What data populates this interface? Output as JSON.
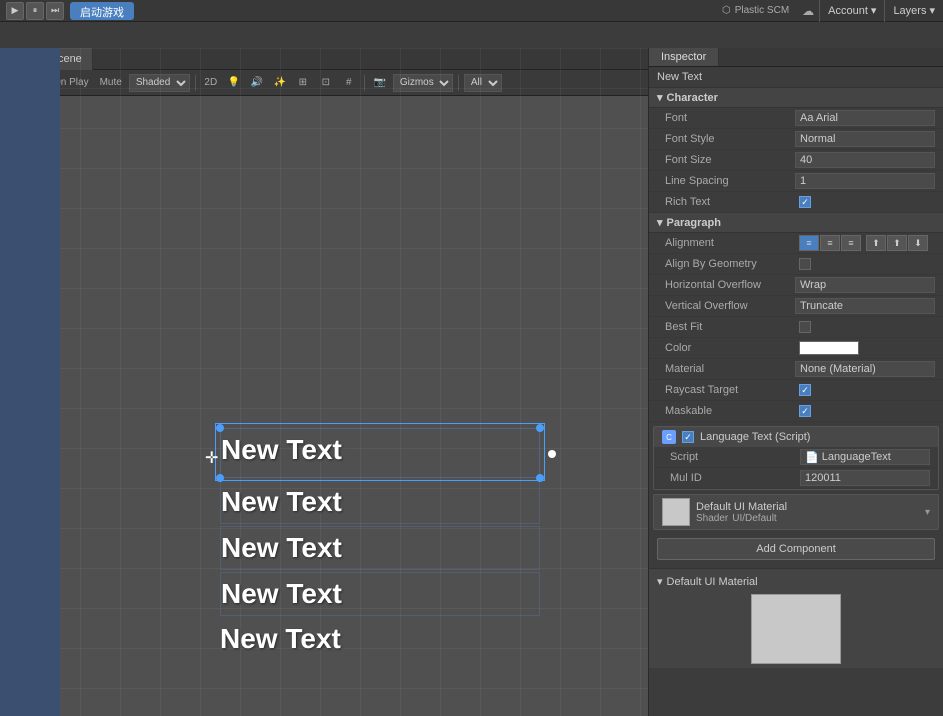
{
  "topbar": {
    "launch_label": "启动游戏",
    "plastic_label": "Plastic SCM",
    "account_label": "Account",
    "layers_label": "Layers"
  },
  "scene_tabs": {
    "scene_label": "Scene",
    "more_label": "⋮"
  },
  "scene_toolbar": {
    "mode_label": "Maximize On Play",
    "mute_label": "Mute",
    "shaded_label": "Shaded",
    "dim_label": "2D",
    "gizmos_label": "Gizmos",
    "all_label": "All"
  },
  "inspector": {
    "title": "Inspector",
    "object_name": "New Text",
    "tabs": [
      "Inspector"
    ]
  },
  "character": {
    "section": "Character",
    "font_label": "Font",
    "font_value": "Aa Arial",
    "font_style_label": "Font Style",
    "font_style_value": "Normal",
    "font_size_label": "Font Size",
    "font_size_value": "40",
    "line_spacing_label": "Line Spacing",
    "line_spacing_value": "1",
    "rich_text_label": "Rich Text"
  },
  "paragraph": {
    "section": "Paragraph",
    "alignment_label": "Alignment",
    "align_by_geometry_label": "Align By Geometry",
    "horiz_overflow_label": "Horizontal Overflow",
    "horiz_overflow_value": "Wrap",
    "vert_overflow_label": "Vertical Overflow",
    "vert_overflow_value": "Truncate",
    "best_fit_label": "Best Fit"
  },
  "color_section": {
    "color_label": "Color",
    "material_label": "Material",
    "material_value": "None (Material)",
    "raycast_label": "Raycast Target",
    "maskable_label": "Maskable"
  },
  "language_text": {
    "component_label": "Language Text (Script)",
    "script_label": "Script",
    "script_value": "LanguageText",
    "mul_id_label": "Mul ID",
    "mul_id_value": "120011"
  },
  "default_material": {
    "label": "Default UI Material",
    "shader_label": "Shader",
    "shader_value": "UI/Default"
  },
  "add_component": {
    "label": "Add Component"
  },
  "bottom_section": {
    "label": "Default UI Material"
  },
  "scene_texts": [
    "New Text",
    "New Text",
    "New Text",
    "New Text",
    "New Text"
  ]
}
